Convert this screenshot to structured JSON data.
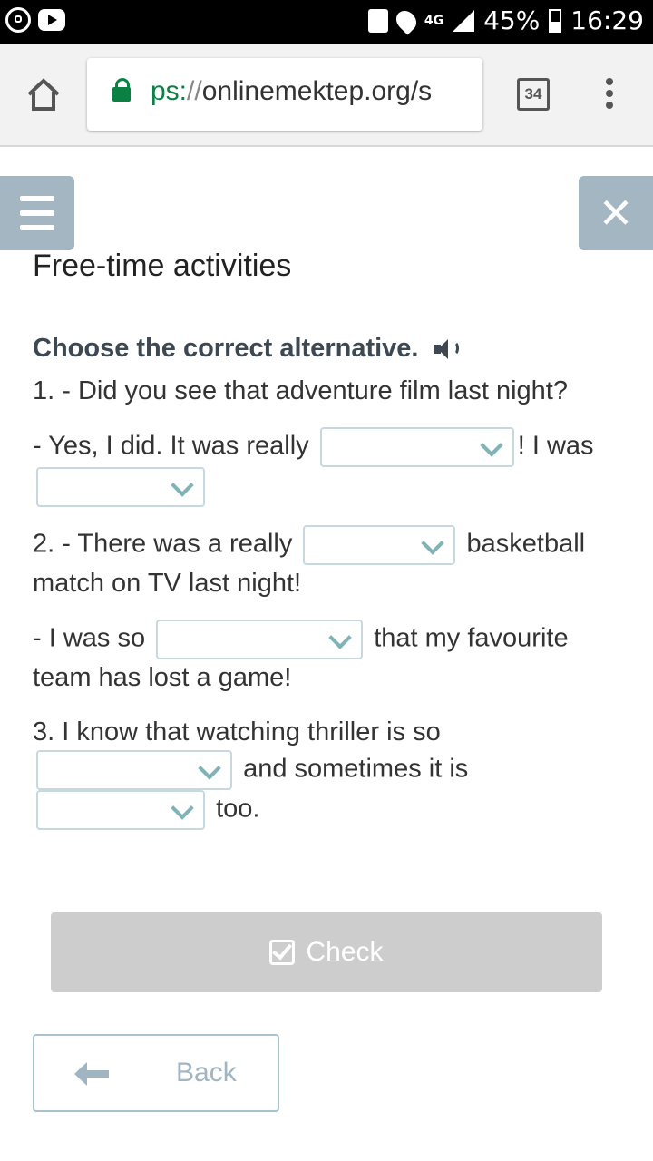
{
  "status_bar": {
    "battery": "45%",
    "time": "16:29",
    "network": "4G"
  },
  "browser": {
    "url_scheme": "ps:",
    "url_sep": "//",
    "url_host": "onlinemektep.org/s",
    "tab_count": "34"
  },
  "page": {
    "title": "Free-time activities",
    "instruction": "Choose the correct alternative.",
    "q1_line1": "1. - Did you see that adventure film last night?",
    "q1_line2a": "- Yes, I did. It was really",
    "q1_line2b": "! I was",
    "q2_a": "2. - There was a really",
    "q2_b": "basketball match on TV last night!",
    "q2_c": "- I was so",
    "q2_d": "that my favourite team has lost a game!",
    "q3_a": "3. I know that watching thriller is so",
    "q3_b": "and sometimes it is",
    "q3_c": "too.",
    "check_label": "Check",
    "back_label": "Back"
  }
}
